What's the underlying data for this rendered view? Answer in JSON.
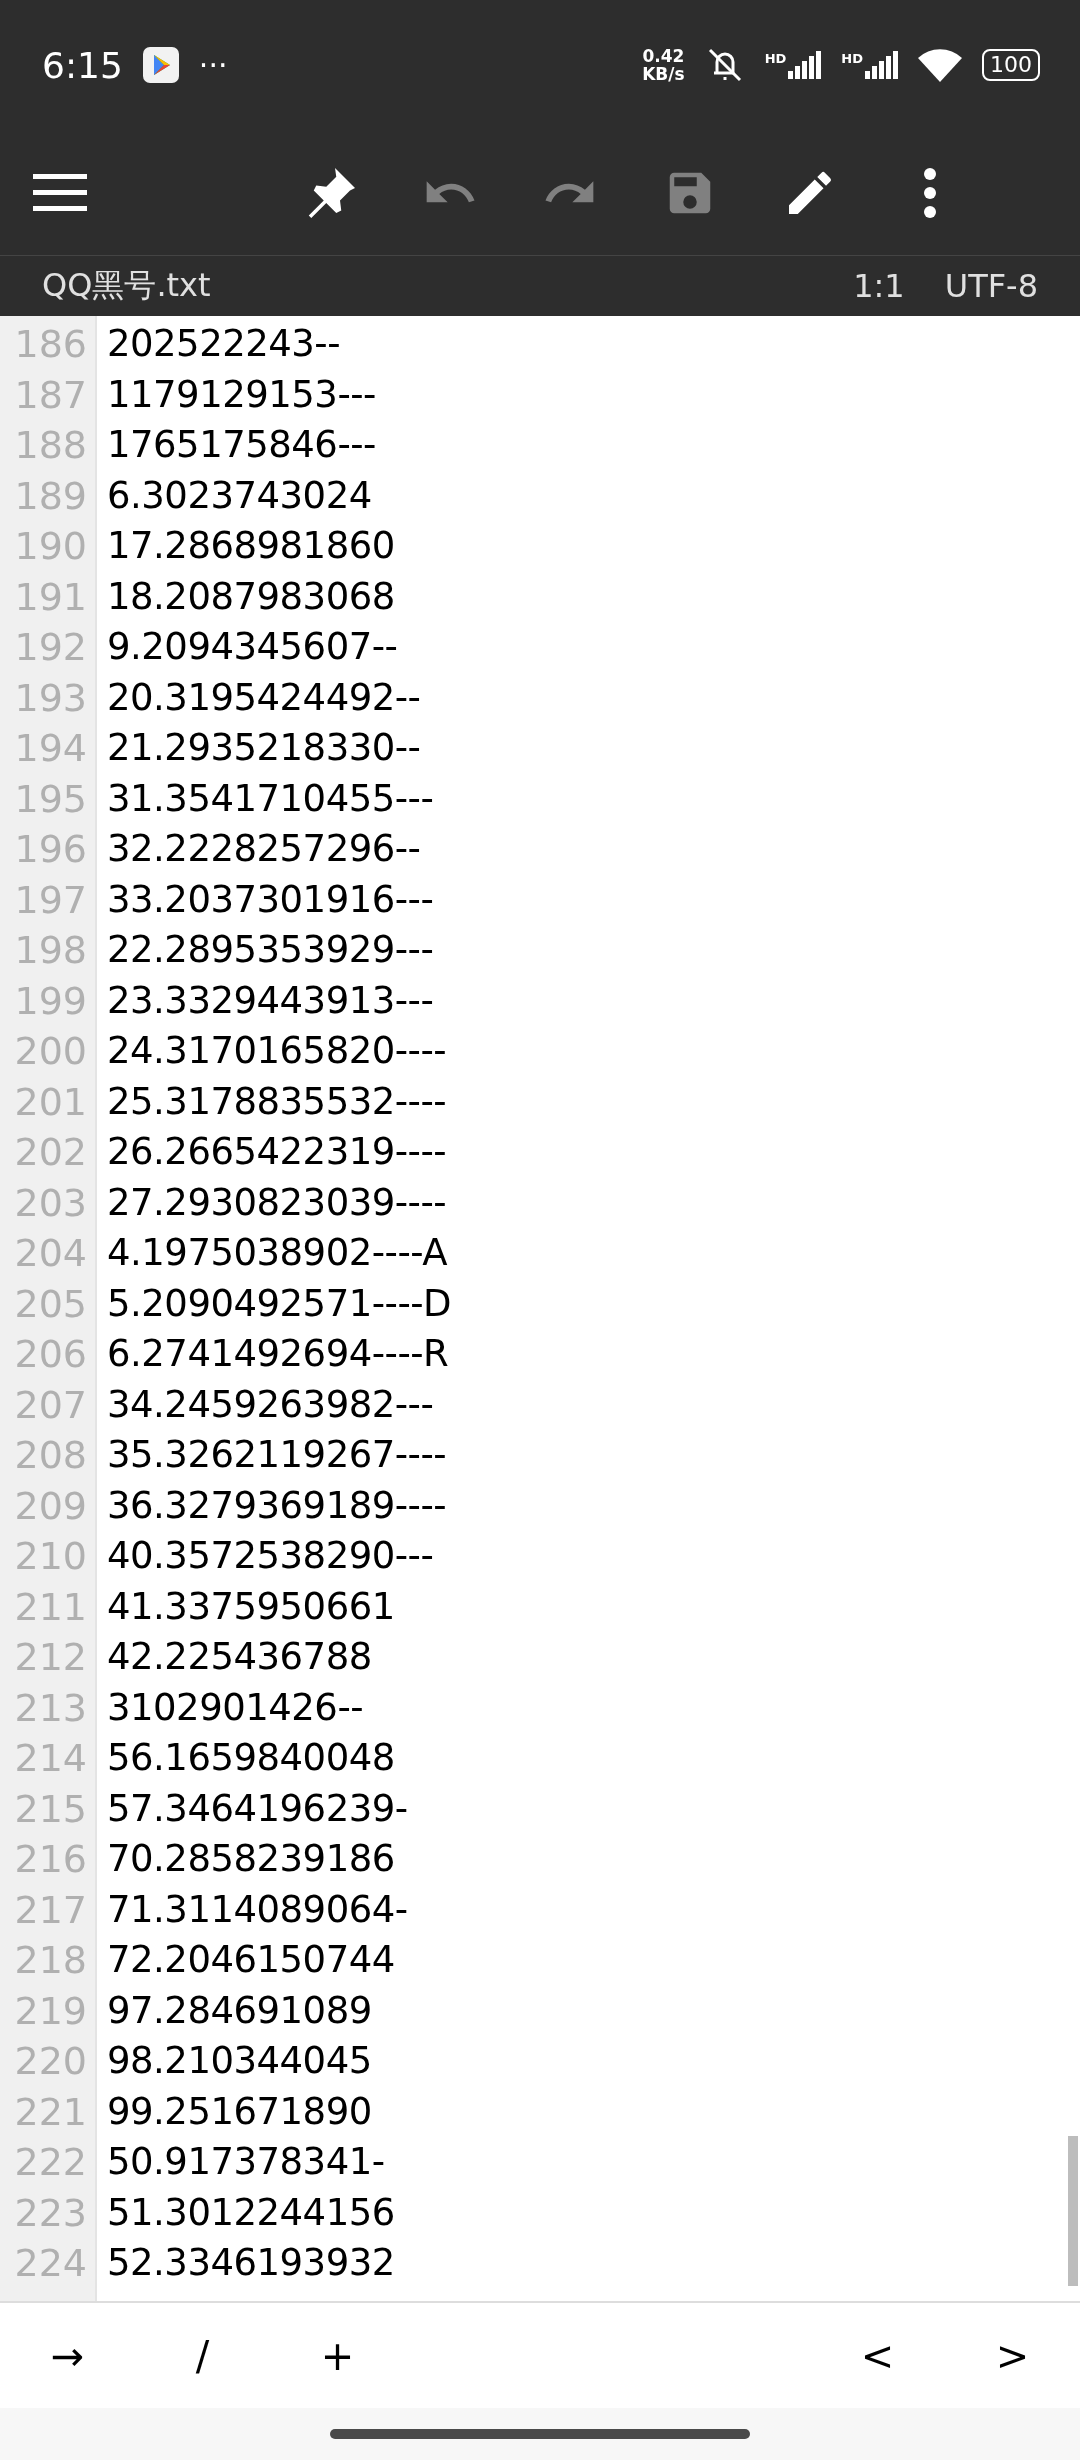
{
  "status_bar": {
    "time": "6:15",
    "more": "···",
    "speed_value": "0.42",
    "speed_unit": "KB/s",
    "signals": [
      {
        "label": "HD"
      },
      {
        "label": "HD"
      }
    ],
    "battery": "100"
  },
  "toolbar": {
    "actions": [
      {
        "kind": "menu",
        "disabled": false
      },
      {
        "kind": "pin",
        "disabled": false
      },
      {
        "kind": "undo",
        "disabled": true
      },
      {
        "kind": "redo",
        "disabled": true
      },
      {
        "kind": "save",
        "disabled": true
      },
      {
        "kind": "edit",
        "disabled": false
      },
      {
        "kind": "more",
        "disabled": false
      }
    ]
  },
  "file_bar": {
    "filename": "QQ黑号.txt",
    "position": "1:1",
    "encoding": "UTF-8"
  },
  "lines": [
    {
      "number": "186",
      "text": "202522243--"
    },
    {
      "number": "187",
      "text": "1179129153---"
    },
    {
      "number": "188",
      "text": "1765175846---"
    },
    {
      "number": "189",
      "text": "6.3023743024"
    },
    {
      "number": "190",
      "text": "17.2868981860"
    },
    {
      "number": "191",
      "text": "18.2087983068"
    },
    {
      "number": "192",
      "text": "9.2094345607--"
    },
    {
      "number": "193",
      "text": "20.3195424492--"
    },
    {
      "number": "194",
      "text": "21.2935218330--"
    },
    {
      "number": "195",
      "text": "31.3541710455---"
    },
    {
      "number": "196",
      "text": "32.2228257296--"
    },
    {
      "number": "197",
      "text": "33.2037301916---"
    },
    {
      "number": "198",
      "text": "22.2895353929---"
    },
    {
      "number": "199",
      "text": "23.3329443913---"
    },
    {
      "number": "200",
      "text": "24.3170165820----"
    },
    {
      "number": "201",
      "text": "25.3178835532----"
    },
    {
      "number": "202",
      "text": "26.2665422319----"
    },
    {
      "number": "203",
      "text": "27.2930823039----"
    },
    {
      "number": "204",
      "text": "4.1975038902----A"
    },
    {
      "number": "205",
      "text": "5.2090492571----D"
    },
    {
      "number": "206",
      "text": "6.2741492694----R"
    },
    {
      "number": "207",
      "text": "34.2459263982---"
    },
    {
      "number": "208",
      "text": "35.3262119267----"
    },
    {
      "number": "209",
      "text": "36.3279369189----"
    },
    {
      "number": "210",
      "text": "40.3572538290---"
    },
    {
      "number": "211",
      "text": "41.3375950661"
    },
    {
      "number": "212",
      "text": "42.225436788"
    },
    {
      "number": "213",
      "text": "3102901426--"
    },
    {
      "number": "214",
      "text": "56.1659840048"
    },
    {
      "number": "215",
      "text": "57.3464196239-"
    },
    {
      "number": "216",
      "text": "70.2858239186"
    },
    {
      "number": "217",
      "text": "71.3114089064-"
    },
    {
      "number": "218",
      "text": "72.2046150744"
    },
    {
      "number": "219",
      "text": "97.284691089"
    },
    {
      "number": "220",
      "text": "98.210344045"
    },
    {
      "number": "221",
      "text": "99.251671890"
    },
    {
      "number": "222",
      "text": "50.917378341-"
    },
    {
      "number": "223",
      "text": "51.3012244156"
    },
    {
      "number": "224",
      "text": "52.3346193932"
    }
  ],
  "keys_left": [
    "→",
    "/",
    "+"
  ],
  "keys_right": [
    "<",
    ">"
  ]
}
